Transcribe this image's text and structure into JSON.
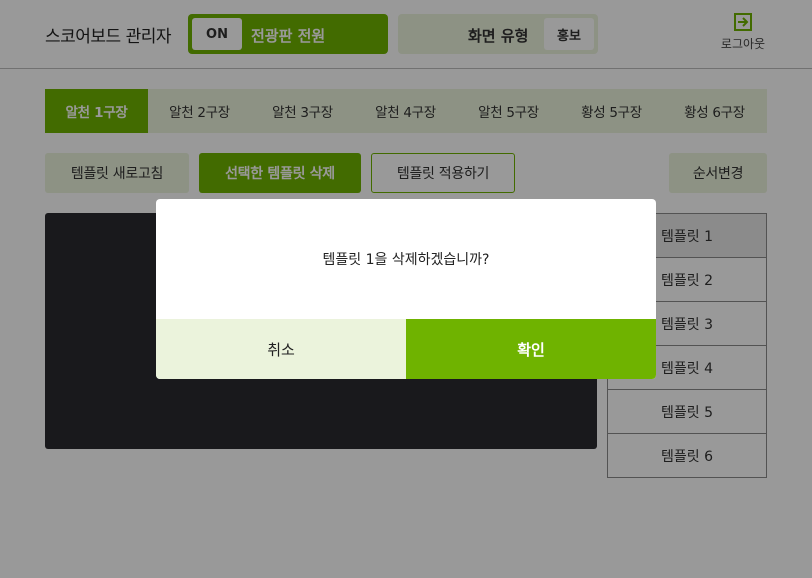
{
  "header": {
    "title": "스코어보드 관리자",
    "power_toggle": {
      "state": "ON",
      "label": "전광판 전원"
    },
    "screen_type": {
      "label": "화면 유형",
      "value": "홍보"
    },
    "logout": {
      "icon": "logout-icon",
      "label": "로그아웃"
    }
  },
  "tabs": [
    {
      "label": "알천 1구장",
      "active": true
    },
    {
      "label": "알천 2구장"
    },
    {
      "label": "알천 3구장"
    },
    {
      "label": "알천 4구장"
    },
    {
      "label": "알천 5구장"
    },
    {
      "label": "황성 5구장"
    },
    {
      "label": "황성 6구장"
    }
  ],
  "toolbar": {
    "refresh_label": "템플릿 새로고침",
    "delete_label": "선택한 템플릿 삭제",
    "apply_label": "템플릿 적용하기",
    "order_label": "순서변경"
  },
  "templates": [
    {
      "label": "템플릿 1",
      "selected": true
    },
    {
      "label": "템플릿 2"
    },
    {
      "label": "템플릿 3"
    },
    {
      "label": "템플릿 4"
    },
    {
      "label": "템플릿 5"
    },
    {
      "label": "템플릿 6"
    }
  ],
  "modal": {
    "message": "템플릿 1을 삭제하겠습니까?",
    "cancel_label": "취소",
    "confirm_label": "확인"
  },
  "colors": {
    "accent": "#6fb300",
    "accent_light": "#ebf3dc",
    "preview_bg": "#2b2b2f"
  }
}
